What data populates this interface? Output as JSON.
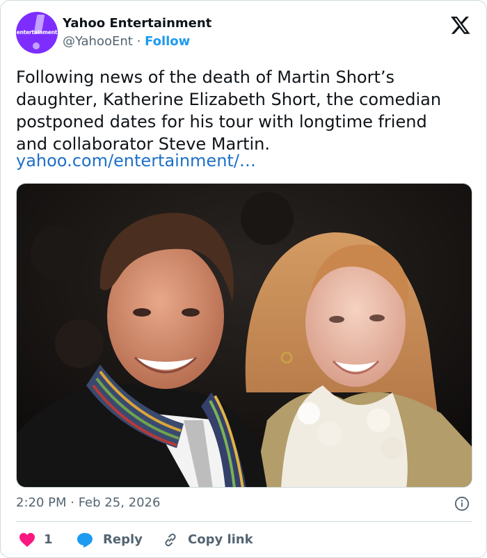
{
  "account": {
    "display_name": "Yahoo Entertainment",
    "handle": "@YahooEnt",
    "separator": "·",
    "follow_label": "Follow",
    "avatar_wordmark": "entertainment",
    "avatar_color": "#7d2eff"
  },
  "platform_icon": "x-logo-icon",
  "tweet": {
    "lines": [
      "Following news of the death of Martin Short’s",
      "daughter, Katherine Elizabeth Short, the comedian",
      "postponed dates for his tour with longtime friend",
      "and collaborator Steve Martin."
    ],
    "link": "yahoo.com/entertainment/…"
  },
  "photo": {
    "subject": "photo-of-two-people"
  },
  "meta": {
    "timestamp": "2:20 PM · Feb 25, 2026"
  },
  "actions": {
    "like_count": "1",
    "reply_label": "Reply",
    "copy_label": "Copy link"
  },
  "colors": {
    "accent": "#1d9bf0",
    "link": "#1d6fc9",
    "heart": "#f91880",
    "muted": "#536471"
  }
}
